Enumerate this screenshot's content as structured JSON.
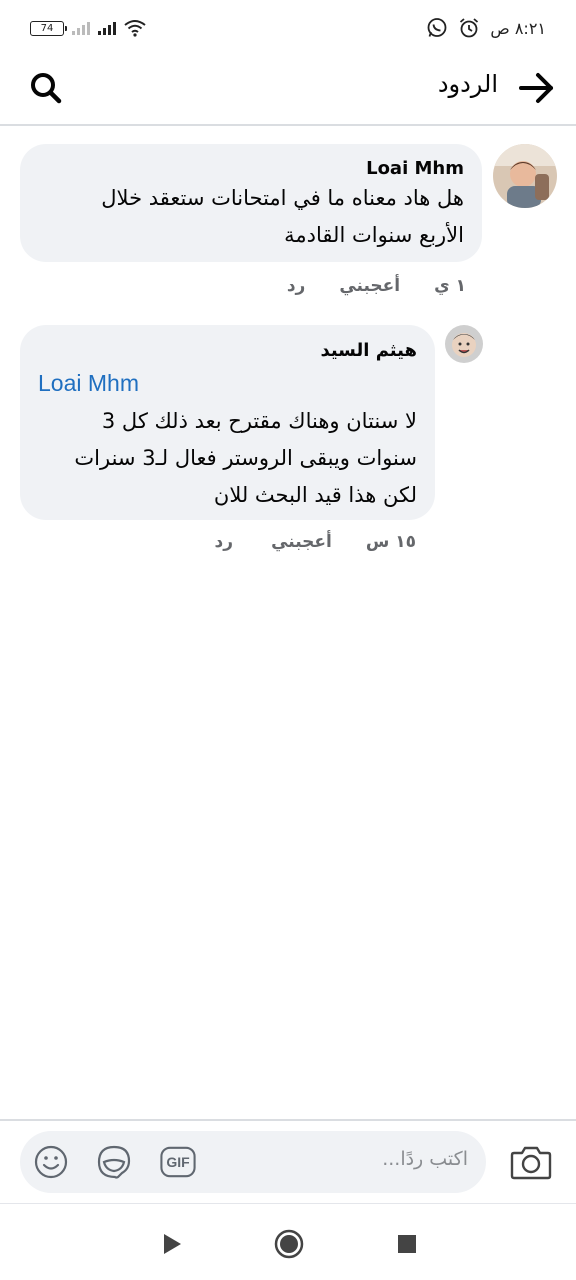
{
  "status_bar": {
    "time": "٨:٢١ ص",
    "battery": "74"
  },
  "header": {
    "title": "الردود"
  },
  "comments": [
    {
      "author": "Loai Mhm",
      "lines": [
        "هل هاد معناه ما في امتحانات ستعقد خلال",
        "الأربع سنوات القادمة"
      ],
      "time": "١ ي",
      "like": "أعجبني",
      "reply": "رد"
    },
    {
      "author": "هيثم السيد",
      "mention": "Loai Mhm",
      "lines": [
        "لا سنتان وهناك مقترح بعد ذلك كل 3",
        "سنوات ويبقى الروستر فعال لـ3 سنرات",
        "لكن هذا قيد البحث للان"
      ],
      "time": "١٥ س",
      "like": "أعجبني",
      "reply": "رد"
    }
  ],
  "composer": {
    "placeholder": "اكتب ردًا...",
    "gif_label": "GIF"
  },
  "colors": {
    "bubble": "#f0f2f5",
    "mention": "#1f6fc0",
    "meta": "#65676b"
  }
}
